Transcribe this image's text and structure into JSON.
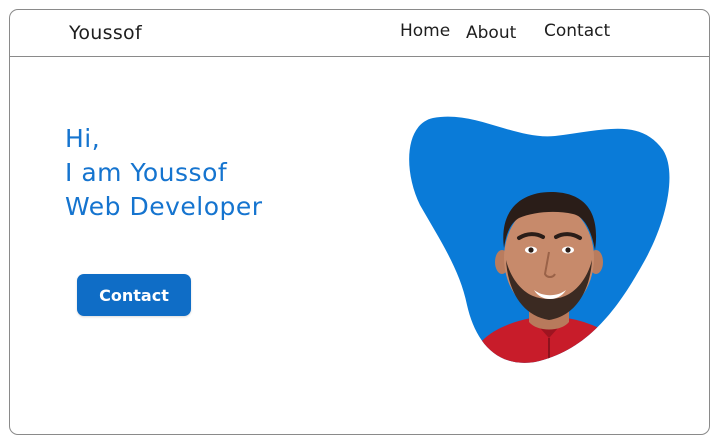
{
  "navbar": {
    "logo": "Youssof",
    "links": [
      {
        "label": "Home"
      },
      {
        "label": "About"
      },
      {
        "label": "Contact"
      }
    ]
  },
  "hero": {
    "lines": [
      "Hi,",
      "I am Youssof",
      "Web Developer"
    ],
    "cta_label": "Contact"
  },
  "colors": {
    "accent": "#1574cf",
    "button": "#0f6dc6",
    "blob": "#0a7bd8",
    "shirt": "#c81c2a"
  }
}
